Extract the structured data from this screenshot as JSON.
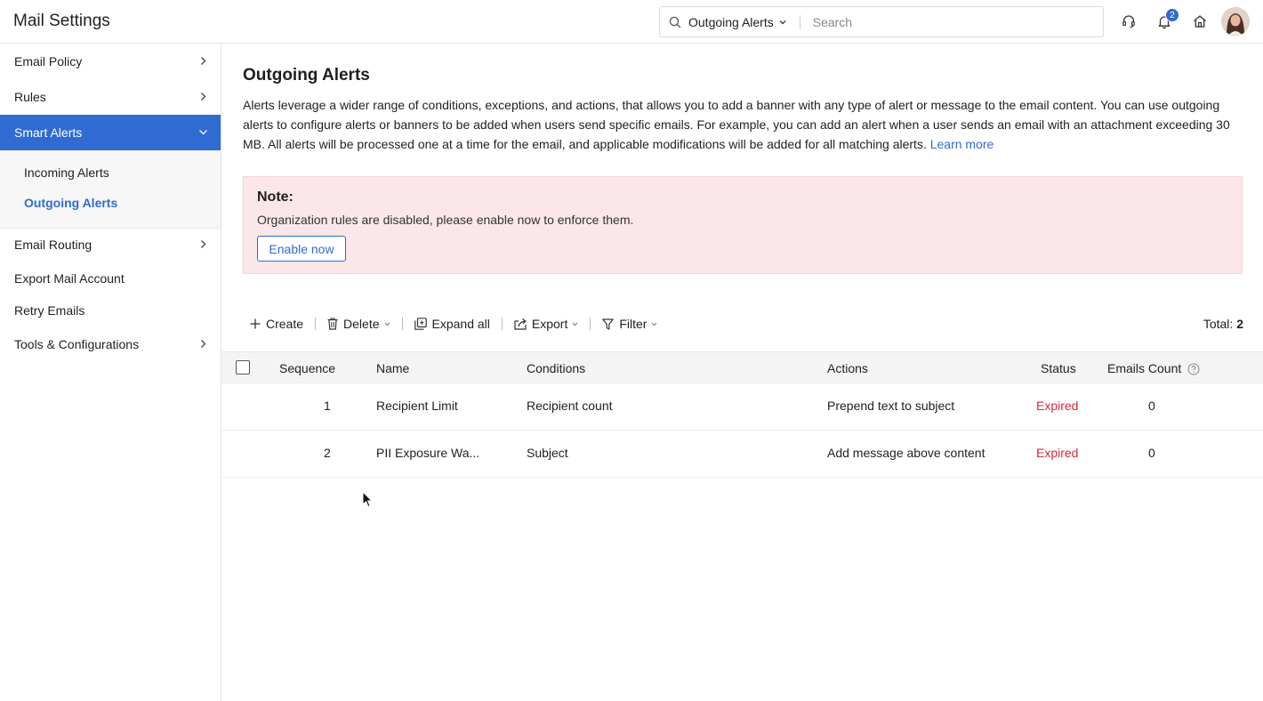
{
  "header": {
    "app_title": "Mail Settings",
    "search_scope": "Outgoing Alerts",
    "search_placeholder": "Search",
    "notification_count": "2"
  },
  "sidebar": {
    "items": [
      {
        "label": "Email Policy"
      },
      {
        "label": "Rules"
      },
      {
        "label": "Smart Alerts"
      },
      {
        "label": "Email Routing"
      },
      {
        "label": "Export Mail Account"
      },
      {
        "label": "Retry Emails"
      },
      {
        "label": "Tools & Configurations"
      }
    ],
    "subitems": [
      {
        "label": "Incoming Alerts"
      },
      {
        "label": "Outgoing Alerts"
      }
    ]
  },
  "main": {
    "title": "Outgoing Alerts",
    "description": "Alerts leverage a wider range of conditions, exceptions, and actions, that allows you to add a banner with any type of alert or message to the email content. You can use outgoing alerts to configure alerts or banners to be added when users send specific emails. For example, you can add an alert when a user sends an email with an attachment exceeding 30 MB. All alerts will be processed one at a time for the email, and applicable modifications will be added for all matching alerts.",
    "learn_more": "Learn more",
    "note": {
      "title": "Note:",
      "text": "Organization rules are disabled, please enable now to enforce them.",
      "button": "Enable now"
    },
    "toolbar": {
      "create": "Create",
      "delete": "Delete",
      "expand_all": "Expand all",
      "export": "Export",
      "filter": "Filter",
      "total_label": "Total:",
      "total_value": "2"
    },
    "table": {
      "columns": [
        "Sequence",
        "Name",
        "Conditions",
        "Actions",
        "Status",
        "Emails Count"
      ],
      "rows": [
        {
          "sequence": "1",
          "name": "Recipient Limit",
          "conditions": "Recipient count",
          "actions": "Prepend text to subject",
          "status": "Expired",
          "emails_count": "0"
        },
        {
          "sequence": "2",
          "name": "PII Exposure Wa...",
          "conditions": "Subject",
          "actions": "Add message above content",
          "status": "Expired",
          "emails_count": "0"
        }
      ]
    }
  },
  "colors": {
    "accent": "#2f6bd1",
    "note_bg": "#fbe7ea",
    "expired": "#d8283a"
  }
}
